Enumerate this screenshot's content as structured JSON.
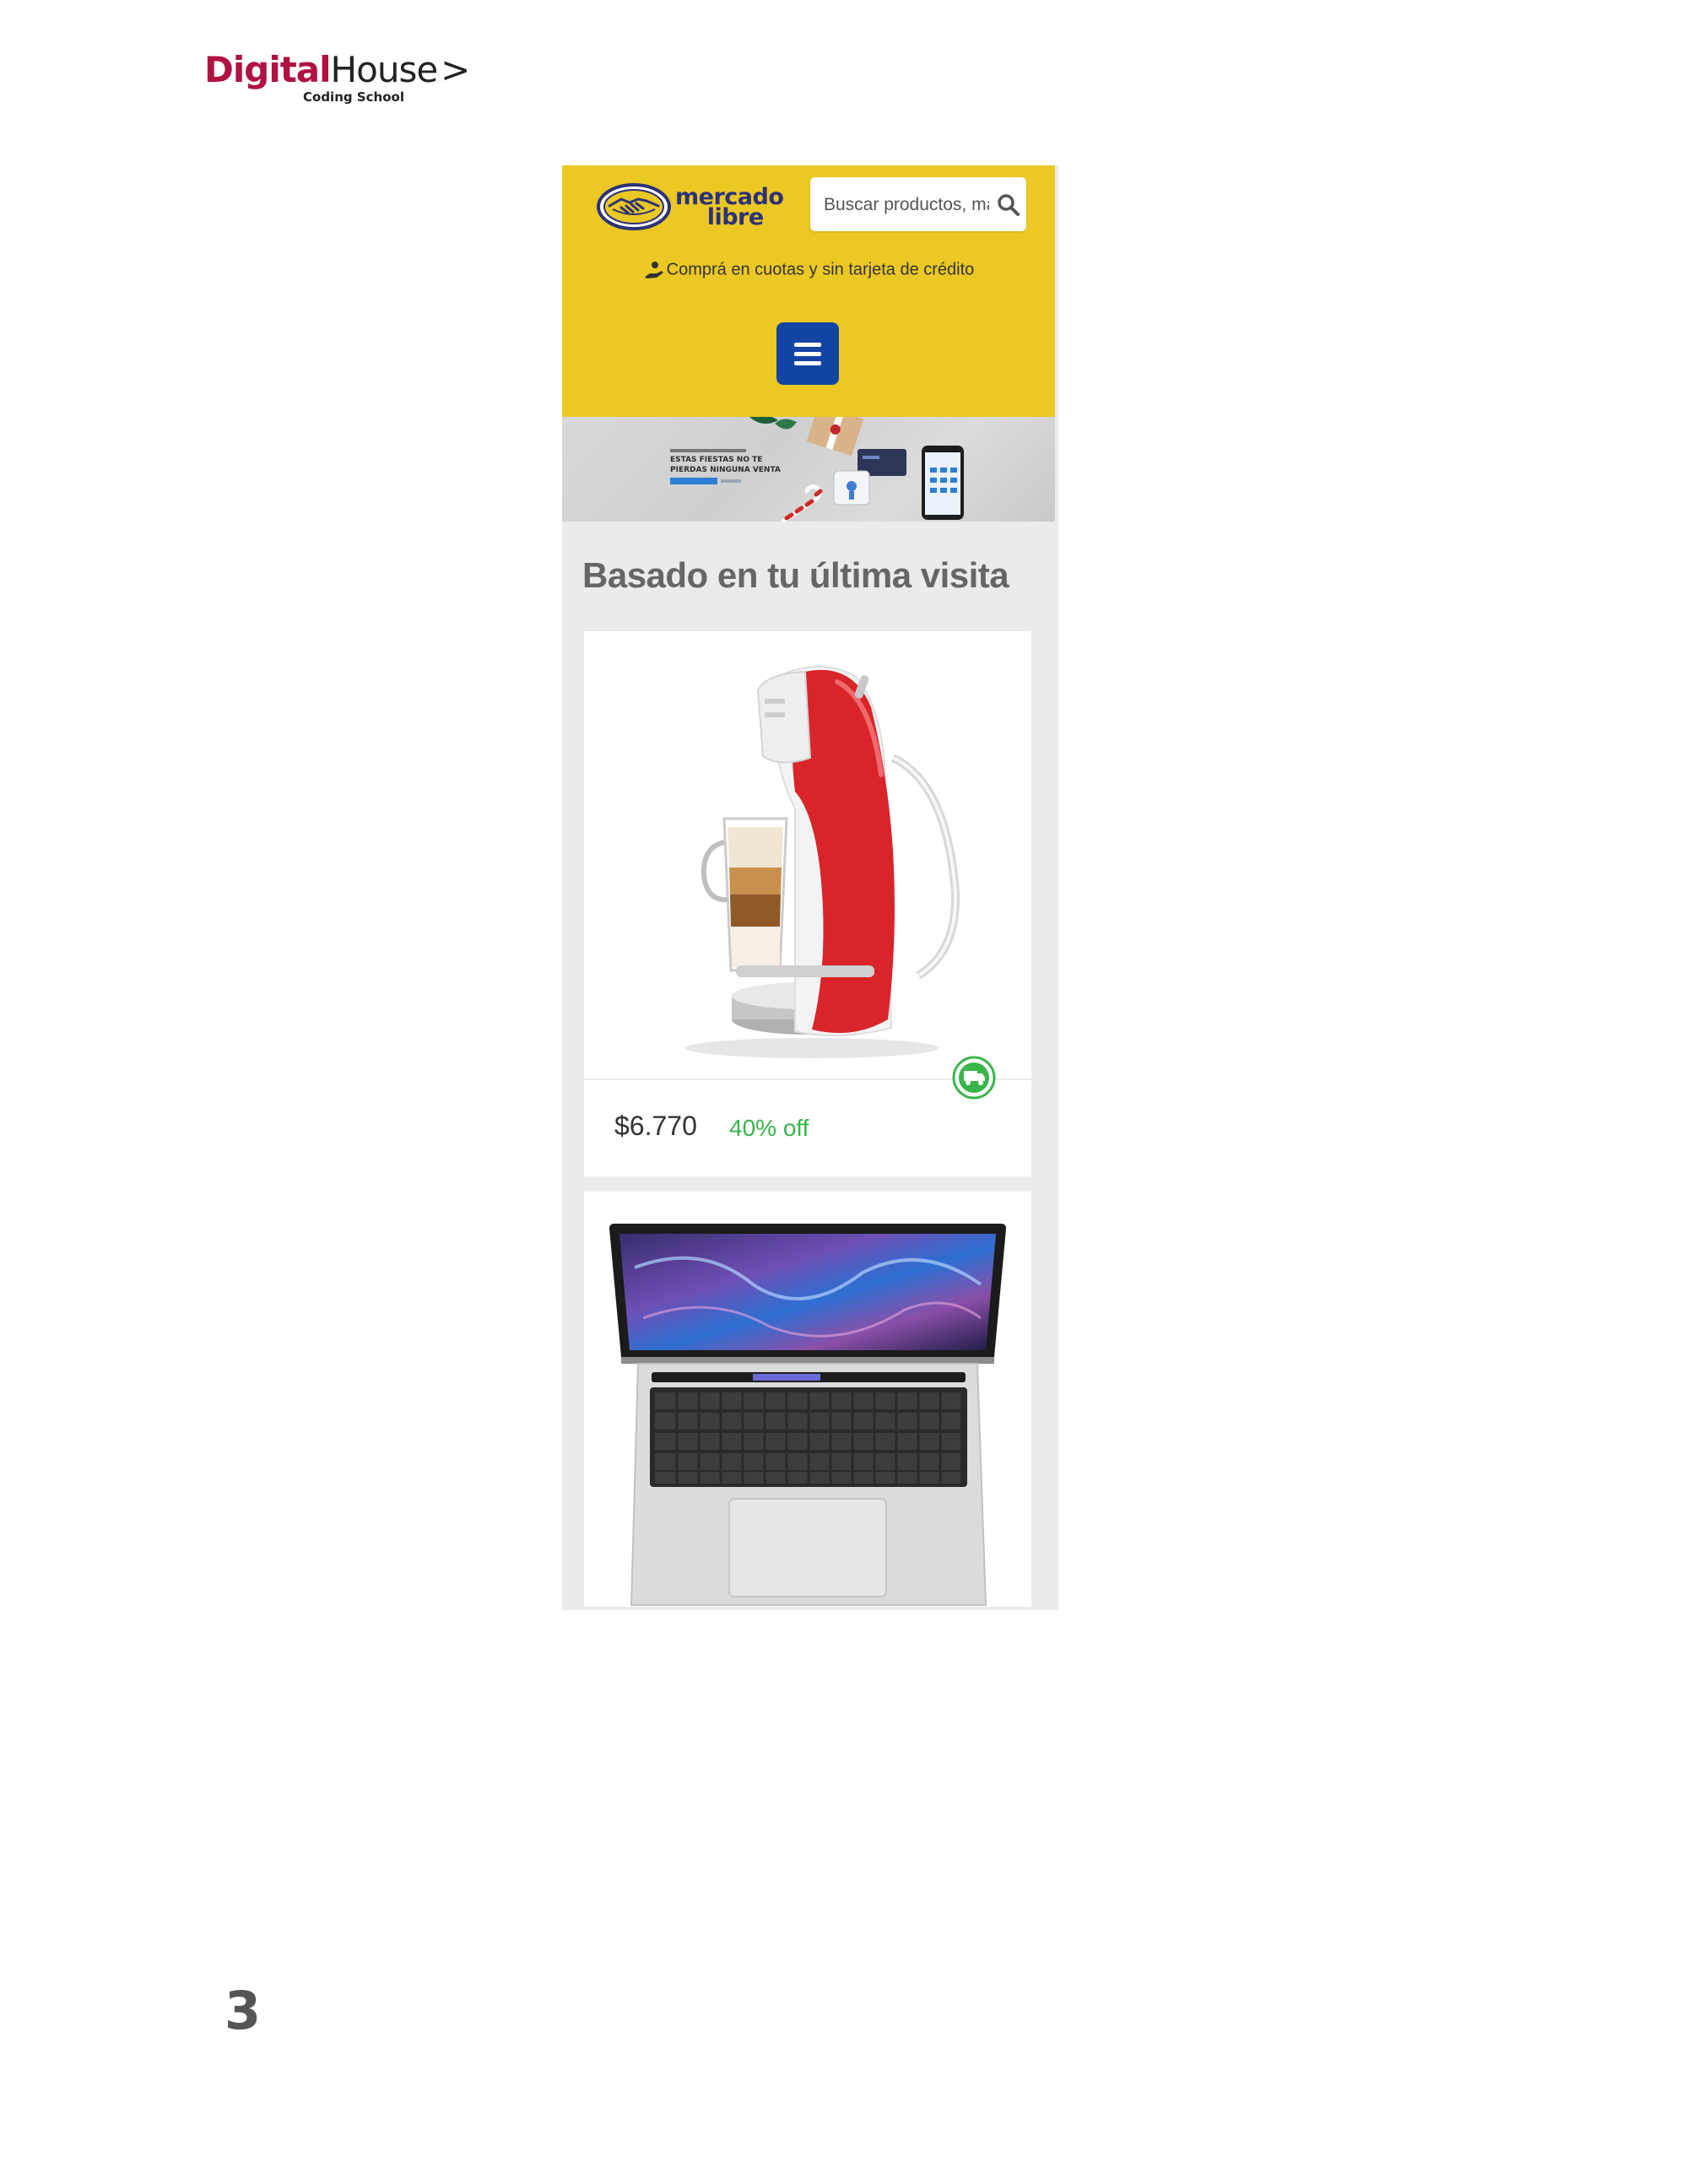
{
  "header": {
    "brand_digital": "Digital",
    "brand_house": "House",
    "brand_chevron": ">",
    "brand_sub": "Coding School"
  },
  "phone": {
    "logo_line1": "mercado",
    "logo_line2": "libre",
    "search_placeholder": "Buscar productos, marcas y más...",
    "promo_text": "Comprá en cuotas y sin tarjeta de crédito",
    "banner_text_line1": "ESTAS FIESTAS NO TE",
    "banner_text_line2": "PIERDAS NINGUNA VENTA",
    "section_title": "Basado en tu última visita",
    "products": [
      {
        "price": "$6.770",
        "discount": "40% off",
        "image_icon": "coffee-machine-icon"
      },
      {
        "image_icon": "laptop-icon"
      }
    ]
  },
  "page_number": "3",
  "colors": {
    "digital_red": "#b0123f",
    "ml_yellow": "#ebc824",
    "ml_blue": "#1244a3",
    "ml_navy": "#2d3277",
    "discount_green": "#39b54a",
    "phone_bg": "#ebebeb"
  }
}
